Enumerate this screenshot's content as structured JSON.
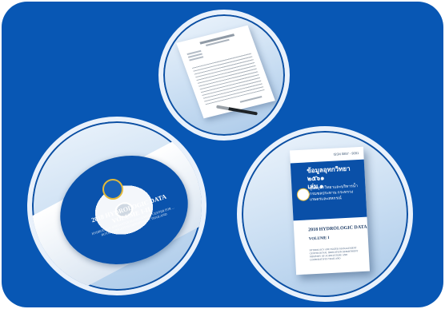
{
  "colors": {
    "background": "#0857b4",
    "circle": "#e9f1fb",
    "cover_blue": "#0a50a8",
    "gold": "#e2b93a"
  },
  "paper": {
    "label": "data sheet with pen"
  },
  "cd": {
    "title_line1": "2018 HYDROLOGIC DATA",
    "title_line2": "VOLUME I-II",
    "subtitle": "HYDROLOGY AND WATER MANAGEMENT CENTER FOR ... ROYAL IRRIGATION DEPARTMENT THAILAND"
  },
  "book": {
    "code": "ISSN 0857 - 9091",
    "thai_title": "ข้อมูลอุทกวิทยา ๒๕๖๑",
    "thai_volume": "เล่ม ๑",
    "thai_subtitle": "ศูนย์อุทกวิทยาและบริหารน้ำ กรมชลประทาน กระทรวงเกษตรและสหกรณ์",
    "en_title": "2018 HYDROLOGIC DATA",
    "en_volume": "VOLUME I",
    "en_org": "HYDROLOGY AND WATER MANAGEMENT CENTER ROYAL IRRIGATION DEPARTMENT MINISTRY OF AGRICULTURE AND COOPERATIVES THAILAND"
  }
}
